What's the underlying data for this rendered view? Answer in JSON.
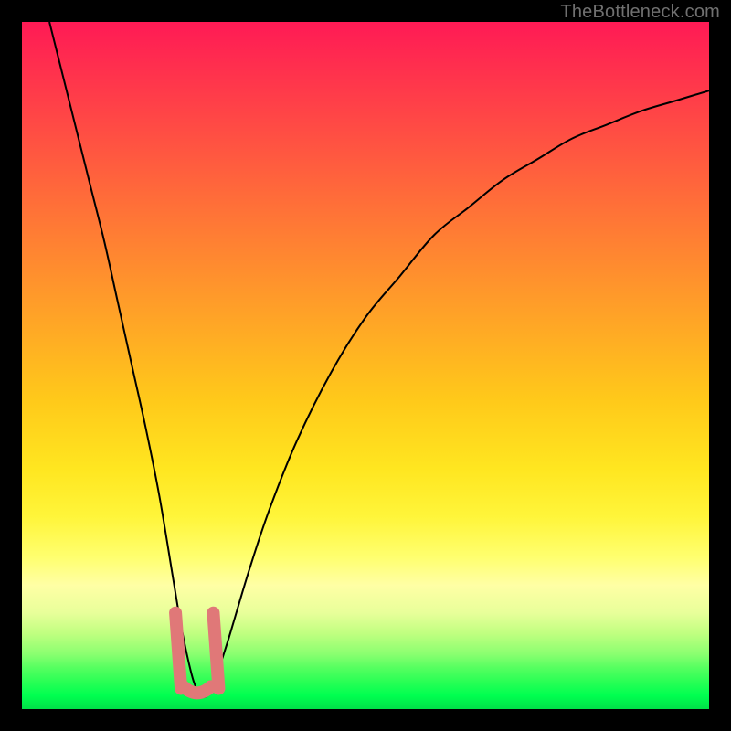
{
  "watermark": "TheBottleneck.com",
  "chart_data": {
    "type": "line",
    "title": "",
    "xlabel": "",
    "ylabel": "",
    "xlim": [
      0,
      100
    ],
    "ylim": [
      0,
      100
    ],
    "series": [
      {
        "name": "bottleneck-curve",
        "x": [
          4,
          6,
          8,
          10,
          12,
          14,
          16,
          18,
          20,
          22,
          23,
          24,
          25,
          26,
          27,
          28,
          30,
          33,
          36,
          40,
          45,
          50,
          55,
          60,
          65,
          70,
          75,
          80,
          85,
          90,
          95,
          100
        ],
        "y": [
          100,
          92,
          84,
          76,
          68,
          59,
          50,
          41,
          31,
          19,
          13,
          8,
          4,
          2,
          2,
          4,
          10,
          20,
          29,
          39,
          49,
          57,
          63,
          69,
          73,
          77,
          80,
          83,
          85,
          87,
          88.5,
          90
        ]
      }
    ],
    "annotations": [
      {
        "name": "pink-highlight-left",
        "x_range": [
          22,
          23.5
        ],
        "y_range": [
          3,
          14
        ]
      },
      {
        "name": "pink-highlight-right",
        "x_range": [
          27.5,
          29
        ],
        "y_range": [
          3,
          14
        ]
      },
      {
        "name": "pink-highlight-bottom",
        "x_range": [
          23.5,
          27.5
        ],
        "y_range": [
          1.5,
          4
        ]
      }
    ],
    "gradient_colors": {
      "top": "#ff1a55",
      "mid": "#ffe620",
      "bottom": "#00e048"
    }
  }
}
